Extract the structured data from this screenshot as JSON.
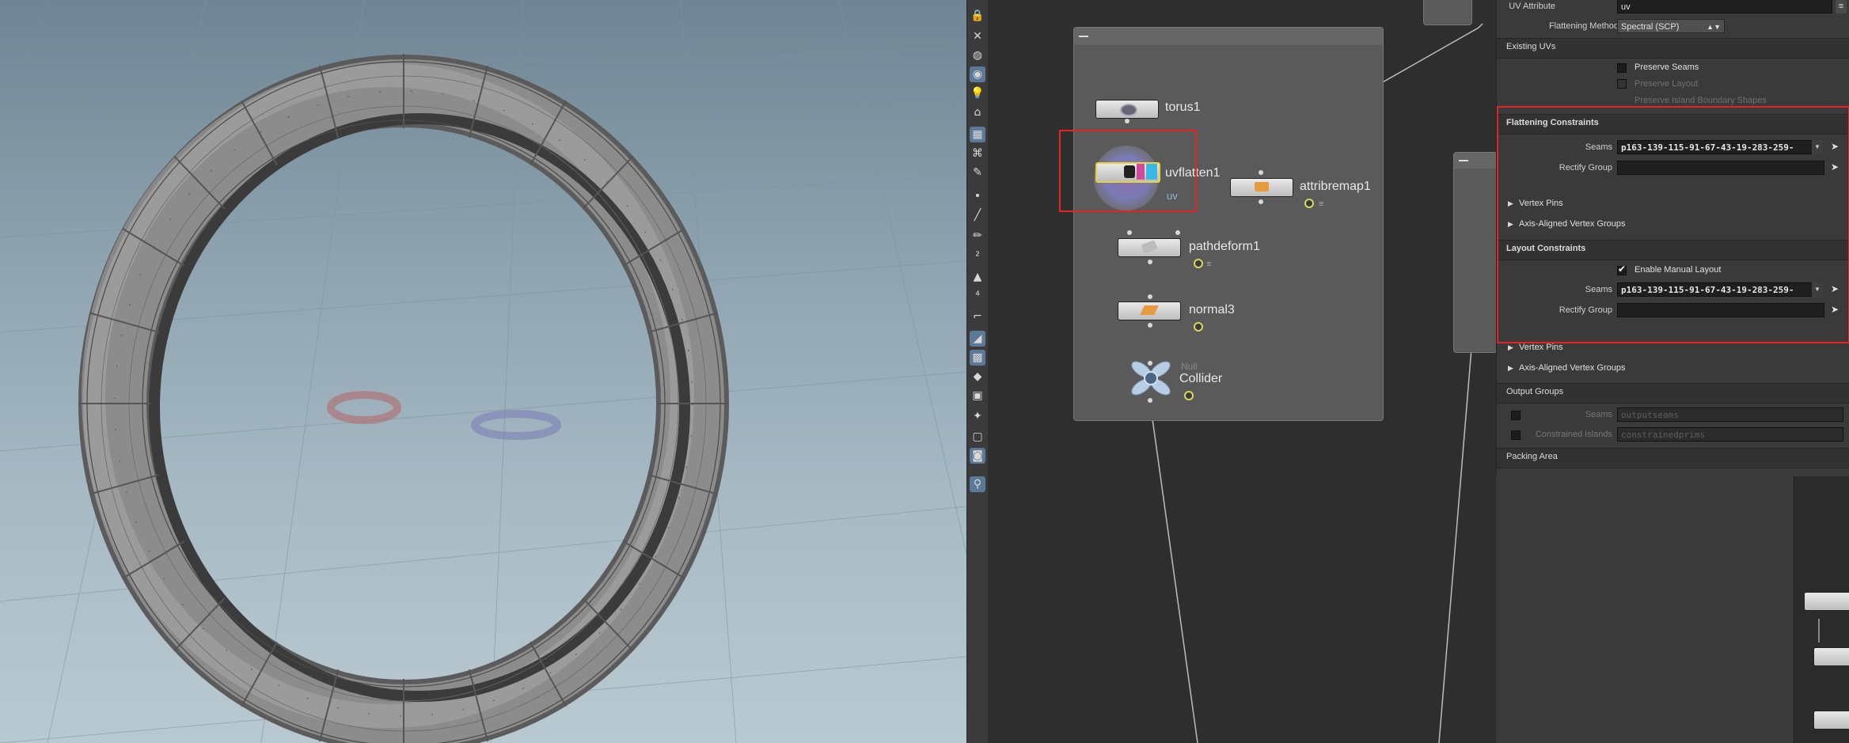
{
  "viewport": {
    "ring_label": "torus with UV checker",
    "floor_glyphs": [
      "0",
      "0"
    ]
  },
  "shelf": {
    "icons": [
      "lock-icon",
      "close-icon",
      "sphere-icon",
      "handle-icon",
      "light-icon",
      "camera-icon",
      "eye-icon",
      "grid-icon",
      "snap-icon",
      "brush-icon",
      "point-icon",
      "edge-icon",
      "pen-icon",
      "number-icon",
      "paint-icon",
      "number-icon",
      "ruler-icon",
      "measure-icon",
      "view-icon",
      "cube-icon",
      "texture-icon",
      "pin-icon",
      "box-icon",
      "display-icon",
      "camera-icon",
      "map-pin-icon"
    ]
  },
  "network": {
    "nodes": {
      "torus": {
        "label": "torus1"
      },
      "uvflatten": {
        "label": "uvflatten1",
        "sub": "uv"
      },
      "attribremap": {
        "label": "attribremap1"
      },
      "pathdeform": {
        "label": "pathdeform1"
      },
      "normal": {
        "label": "normal3"
      },
      "collider": {
        "label": "Collider",
        "sub": "Null"
      }
    }
  },
  "params": {
    "uv_attribute": {
      "label": "UV Attribute",
      "value": "uv"
    },
    "flattening_method": {
      "label": "Flattening Method",
      "value": "Spectral (SCP)"
    },
    "existing_uvs": {
      "title": "Existing UVs"
    },
    "preserve_seams": {
      "label": "Preserve Seams"
    },
    "preserve_layout": {
      "label": "Preserve Layout"
    },
    "preserve_island": {
      "label": "Preserve Island Boundary Shapes"
    },
    "flattening_constraints": {
      "title": "Flattening Constraints",
      "seams_label": "Seams",
      "seams_value": "p163-139-115-91-67-43-19-283-259-",
      "rectify_label": "Rectify Group",
      "rectify_value": "",
      "vertex_pins": "Vertex Pins",
      "axis_aligned": "Axis-Aligned Vertex Groups"
    },
    "layout_constraints": {
      "title": "Layout Constraints",
      "enable_manual": "Enable Manual Layout",
      "seams_label": "Seams",
      "seams_value": "p163-139-115-91-67-43-19-283-259-",
      "rectify_label": "Rectify Group",
      "rectify_value": "",
      "vertex_pins": "Vertex Pins",
      "axis_aligned": "Axis-Aligned Vertex Groups"
    },
    "output_groups": {
      "title": "Output Groups",
      "seams_label": "Seams",
      "seams_value": "outputseams",
      "islands_label": "Constrained Islands",
      "islands_value": "constrainedprims"
    },
    "packing_area": {
      "title": "Packing Area"
    }
  },
  "colors": {
    "highlight": "#e42424",
    "selected_node": "#e8d23a"
  }
}
